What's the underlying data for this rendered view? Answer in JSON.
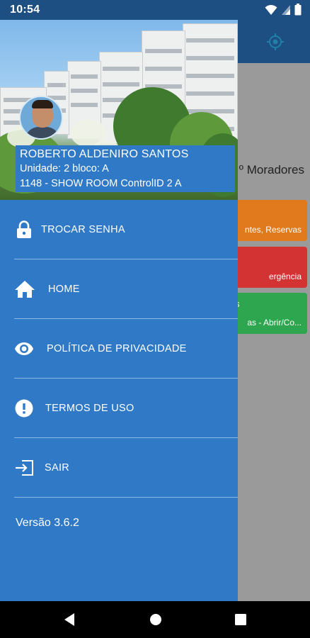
{
  "status": {
    "time": "10:54"
  },
  "background_app": {
    "moradores_label": "º Moradores",
    "cards": [
      {
        "text": "ntes, Reservas",
        "color": "#e07a1d"
      },
      {
        "text": "ergência",
        "color": "#d43333"
      },
      {
        "top_text": "s",
        "text": "as - Abrir/Co...",
        "color": "#2ea64f"
      }
    ]
  },
  "drawer": {
    "user": {
      "name": "ROBERTO ALDENIRO SANTOS",
      "unit": "Unidade: 2 bloco: A",
      "location": "1148 - SHOW ROOM ControlID 2 A"
    },
    "menu": [
      {
        "label": "TROCAR SENHA",
        "icon": "lock-icon"
      },
      {
        "label": "HOME",
        "icon": "home-icon"
      },
      {
        "label": "POLÍTICA DE PRIVACIDADE",
        "icon": "eye-icon"
      },
      {
        "label": "TERMOS DE USO",
        "icon": "alert-circle-icon"
      },
      {
        "label": "SAIR",
        "icon": "logout-icon"
      }
    ],
    "version": "Versão 3.6.2"
  },
  "colors": {
    "drawer": "#2f79c6",
    "toolbar": "#1e4f82",
    "scrim": "#9a9a9a"
  }
}
